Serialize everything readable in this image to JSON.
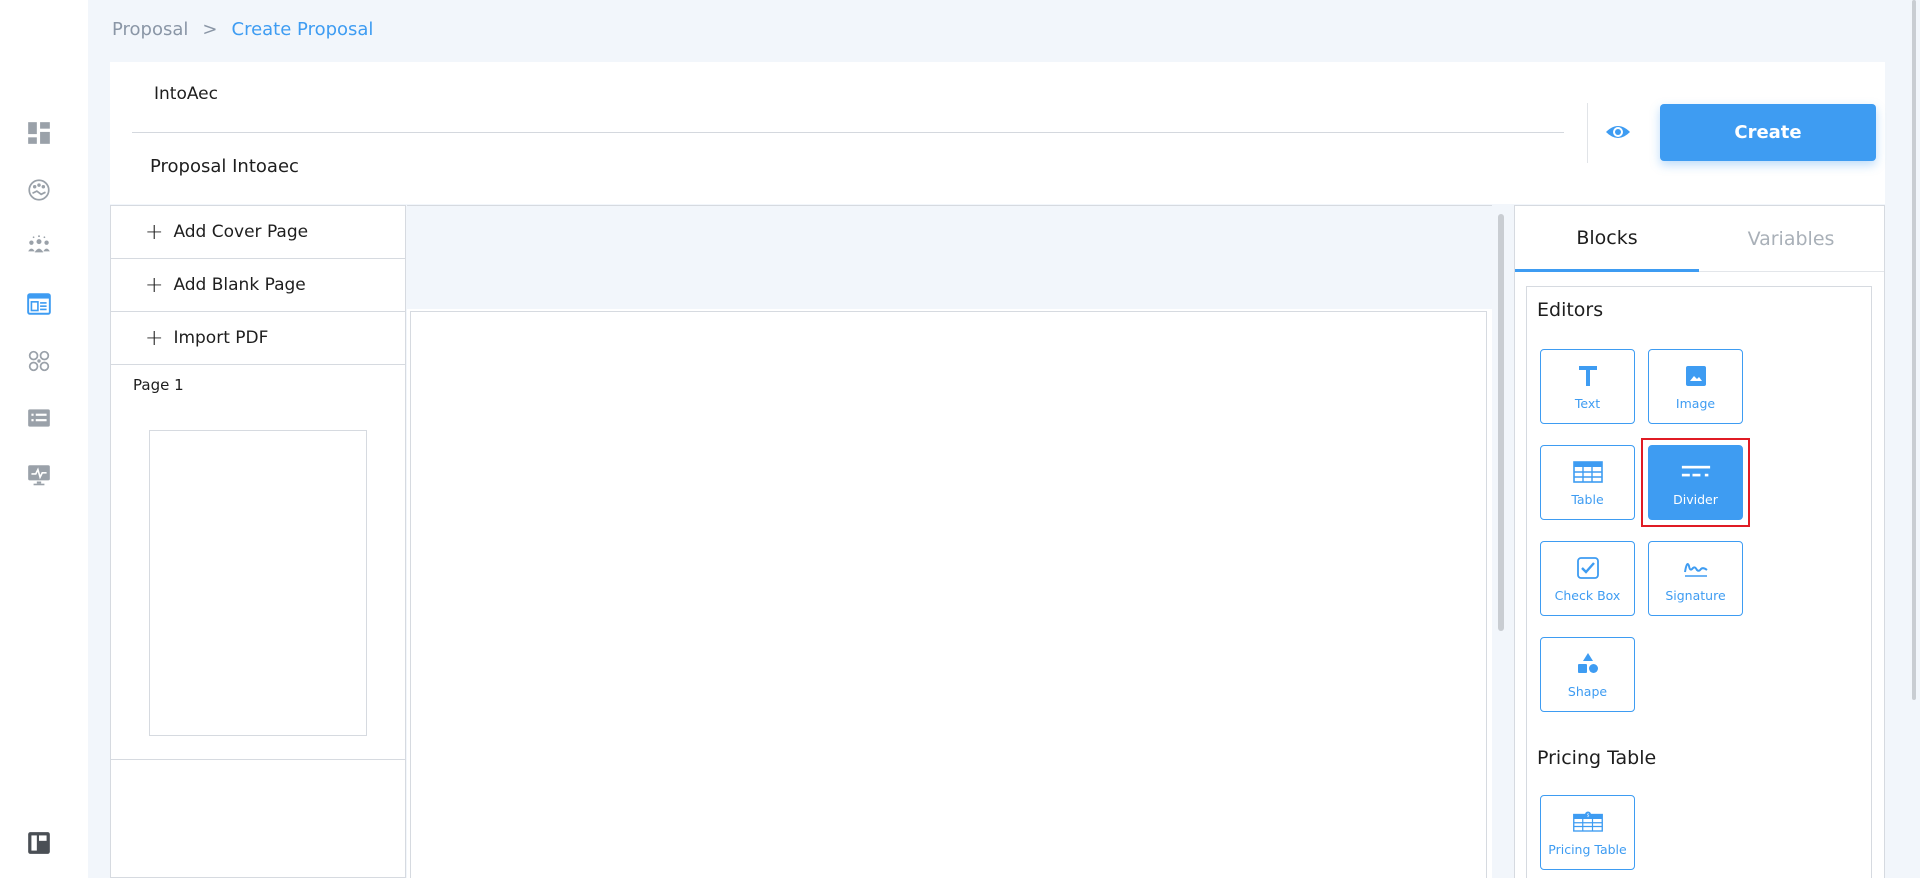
{
  "breadcrumb": {
    "parent": "Proposal",
    "separator": ">",
    "current": "Create Proposal"
  },
  "header": {
    "company_value": "IntoAec",
    "proposal_name_value": "Proposal Intoaec",
    "create_label": "Create"
  },
  "rail_icons": [
    "dashboard-icon",
    "handshake-icon",
    "team-icon",
    "proposal-icon",
    "modules-icon",
    "list-icon",
    "monitor-icon",
    "layout-icon"
  ],
  "pages_panel": {
    "add_cover": "Add Cover Page",
    "add_blank": "Add Blank Page",
    "import_pdf": "Import PDF",
    "plus": "+",
    "page_label": "Page 1"
  },
  "right_panel": {
    "tabs": {
      "blocks": "Blocks",
      "variables": "Variables"
    },
    "editors_title": "Editors",
    "editors": {
      "text": "Text",
      "image": "Image",
      "table": "Table",
      "divider": "Divider",
      "checkbox": "Check Box",
      "signature": "Signature",
      "shape": "Shape"
    },
    "pricing_title": "Pricing Table",
    "pricing_block": "Pricing Table"
  },
  "colors": {
    "accent": "#3e9cf2",
    "highlight": "#e01b24",
    "background": "#f2f6fb"
  }
}
